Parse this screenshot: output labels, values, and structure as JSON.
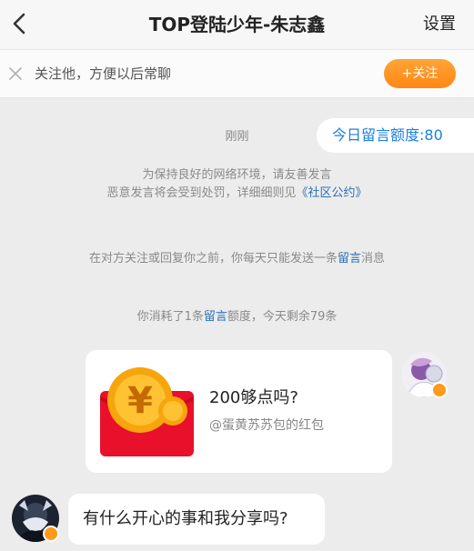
{
  "header": {
    "title": "TOP登陆少年-朱志鑫",
    "settings_label": "设置"
  },
  "follow_bar": {
    "text": "关注他，方便以后常聊",
    "button_label": "+关注"
  },
  "quota": {
    "label": "今日留言额度:80"
  },
  "messages": {
    "timestamp": "刚刚",
    "policy_line1": "为保持良好的网络环境，请友善发言",
    "policy_line2_prefix": "恶意发言将会受到处罚，详细细则见",
    "policy_link": "《社区公约》",
    "notice_prefix": "在对方关注或回复你之前，你每天只能发送一条",
    "notice_highlight": "留言",
    "notice_suffix": "消息",
    "consumed_prefix": "你消耗了1条",
    "consumed_highlight": "留言",
    "consumed_suffix": "额度，今天剩余79条"
  },
  "red_packet": {
    "title": "200够点吗?",
    "subtitle": "@蛋黄苏苏包的红包",
    "symbol": "¥"
  },
  "incoming": {
    "text": "有什么开心的事和我分享吗?"
  },
  "colors": {
    "accent_orange": "#ff8c1a",
    "link_blue": "#2b6fb8",
    "quota_blue": "#1a7fe0",
    "envelope_red": "#e8102a",
    "coin_gold": "#f6a50c"
  }
}
